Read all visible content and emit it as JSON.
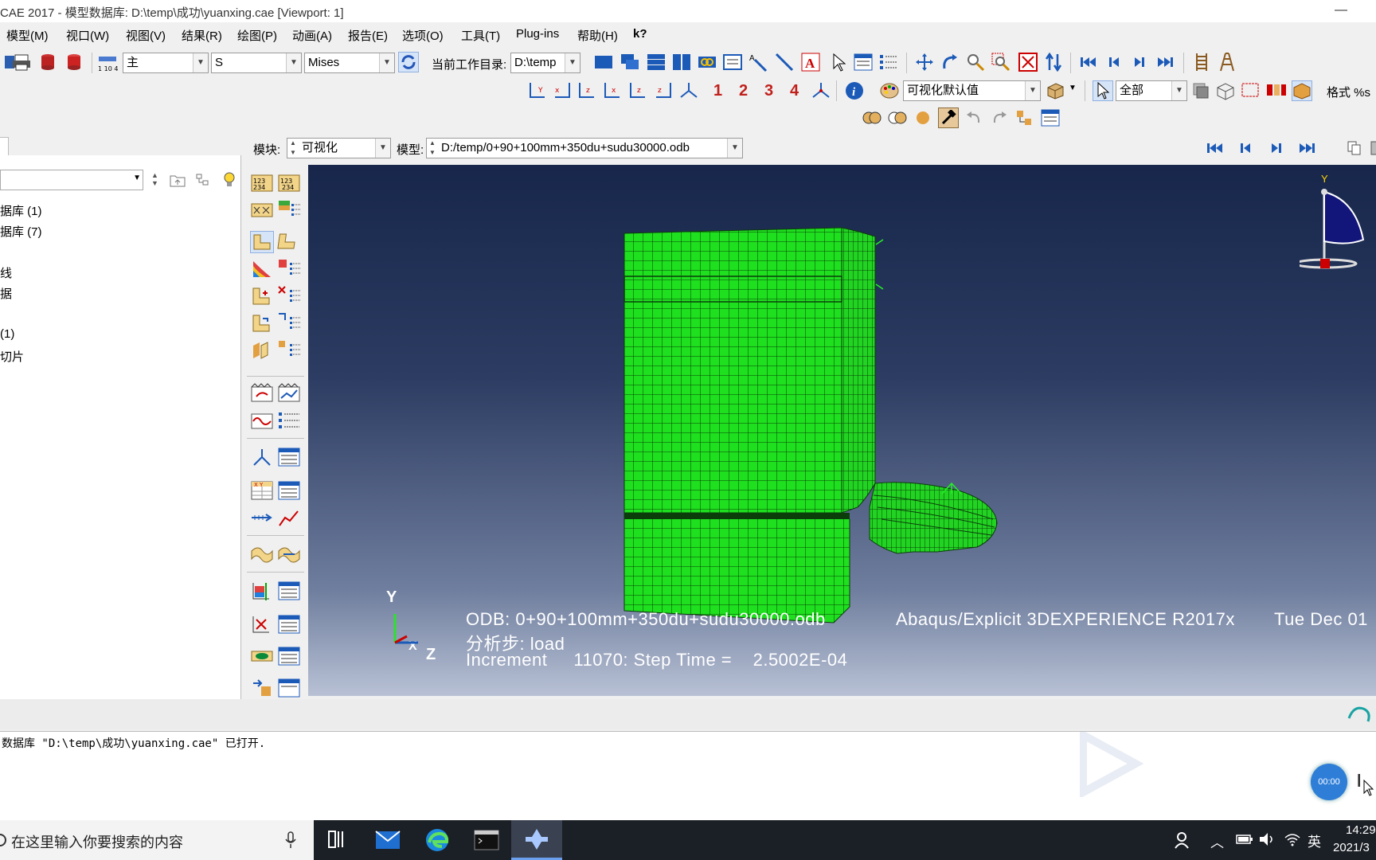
{
  "window": {
    "title": "CAE 2017 - 模型数据库: D:\\temp\\成功\\yuanxing.cae [Viewport: 1]",
    "minimize": "—"
  },
  "menubar": [
    "模型(M)",
    "视口(W)",
    "视图(V)",
    "结果(R)",
    "绘图(P)",
    "动画(A)",
    "报告(E)",
    "选项(O)",
    "工具(T)",
    "Plug-ins",
    "帮助(H)",
    "k?"
  ],
  "toolbar1": {
    "combo_step": "主",
    "combo_field": "S",
    "combo_invariant": "Mises",
    "workdir_label": "当前工作目录:",
    "workdir_value": "D:\\temp"
  },
  "toolbar2": {
    "digits": [
      "1",
      "2",
      "3",
      "4"
    ],
    "visual_default": "可视化默认值",
    "select_all": "全部",
    "format_label": "格式 %s"
  },
  "context_bar": {
    "module_label": "模块:",
    "module_value": "可视化",
    "model_label": "模型:",
    "model_value": "D:/temp/0+90+100mm+350du+sudu30000.odb"
  },
  "tree": {
    "items": [
      "据库 (1)",
      "据库 (7)",
      "线",
      "据",
      "(1)",
      "切片"
    ]
  },
  "viewport": {
    "legend_odb": "ODB: 0+90+100mm+350du+sudu30000.odb",
    "legend_solver": "Abaqus/Explicit 3DEXPERIENCE R2017x",
    "legend_date": "Tue Dec 01",
    "legend_step": "分析步: load",
    "legend_increment": "Increment     11070: Step Time =    2.5002E-04",
    "triad_y": "Y",
    "triad_z": "Z",
    "triad_x": "X",
    "view_cube_y": "Y",
    "view_cube_x": "X",
    "colors": {
      "mesh_fill": "#1ee01e",
      "mesh_line": "#0b3d0b"
    }
  },
  "message_area": {
    "line1": "数据库 \"D:\\temp\\成功\\yuanxing.cae\" 已打开."
  },
  "recorder": {
    "time": "00:00"
  },
  "taskbar": {
    "search_placeholder": "在这里输入你要搜索的内容",
    "ime": "英",
    "time": "14:29",
    "date": "2021/3"
  }
}
